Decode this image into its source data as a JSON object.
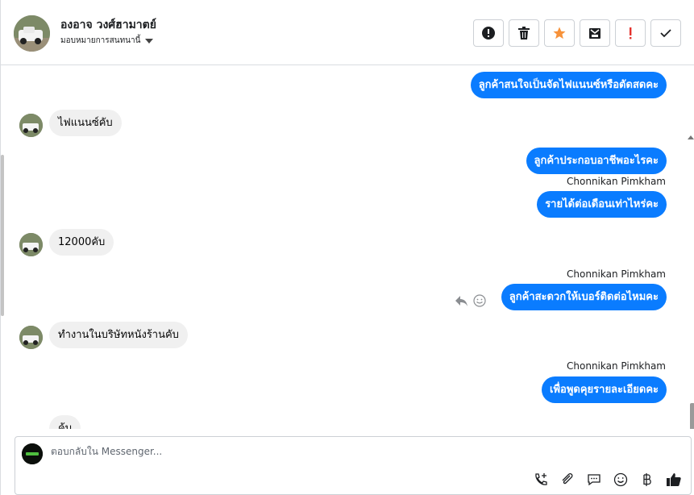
{
  "header": {
    "contact_name": "องอาจ วงศ์ฮามาตย์",
    "assign_label": "มอบหมายการสนทนานี้",
    "actions": [
      {
        "name": "report-button",
        "icon": "alert-circle-icon"
      },
      {
        "name": "delete-button",
        "icon": "trash-icon"
      },
      {
        "name": "star-button",
        "icon": "star-icon"
      },
      {
        "name": "archive-button",
        "icon": "archive-icon"
      },
      {
        "name": "important-button",
        "icon": "exclamation-icon"
      },
      {
        "name": "done-button",
        "icon": "check-icon"
      }
    ]
  },
  "messages": {
    "m1": "ลูกค้าสนใจเป็นจัดไฟแนนซ์หรือตัดสดคะ",
    "m2": "ไฟแนนซ์คับ",
    "m3": "ลูกค้าประกอบอาชีพอะไรคะ",
    "m4_sender": "Chonnikan Pimkham",
    "m4": "รายได้ต่อเดือนเท่าไหร่คะ",
    "m5": "12000คับ",
    "m6_sender": "Chonnikan Pimkham",
    "m6": "ลูกค้าสะดวกให้เบอร์ติดต่อไหมคะ",
    "m7": "ทำงานในบริษัทหนังร้านคับ",
    "m8_sender": "Chonnikan Pimkham",
    "m8": "เพื่อพูดคุยรายละเอียดคะ",
    "m9": "ค้บ"
  },
  "composer": {
    "placeholder": "ตอบกลับใน Messenger...",
    "tools": [
      "add-call-icon",
      "attachment-icon",
      "saved-reply-icon",
      "emoji-icon",
      "baht-icon",
      "like-icon"
    ]
  },
  "colors": {
    "outgoing_bubble": "#0a7cff",
    "incoming_bubble": "#f0f0f0",
    "star": "#f7923a",
    "important": "#e4322d"
  }
}
